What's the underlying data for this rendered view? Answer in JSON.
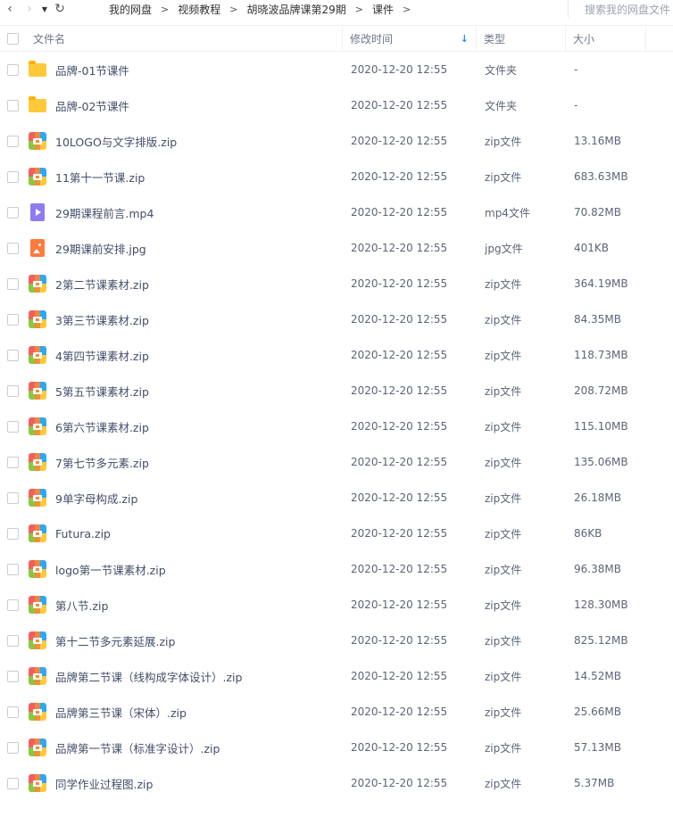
{
  "nav": {
    "breadcrumbs": [
      "我的网盘",
      "视频教程",
      "胡晓波品牌课第29期",
      "课件"
    ],
    "separator": ">",
    "search_placeholder": "搜索我的网盘文件"
  },
  "columns": {
    "name": "文件名",
    "mtime": "修改时间",
    "type": "类型",
    "size": "大小",
    "sort_indicator": "↓"
  },
  "files": [
    {
      "name": "品牌-01节课件",
      "mtime": "2020-12-20 12:55",
      "type": "文件夹",
      "size": "-",
      "icon": "folder"
    },
    {
      "name": "品牌-02节课件",
      "mtime": "2020-12-20 12:55",
      "type": "文件夹",
      "size": "-",
      "icon": "folder"
    },
    {
      "name": "10LOGO与文字排版.zip",
      "mtime": "2020-12-20 12:55",
      "type": "zip文件",
      "size": "13.16MB",
      "icon": "zip"
    },
    {
      "name": "11第十一节课.zip",
      "mtime": "2020-12-20 12:55",
      "type": "zip文件",
      "size": "683.63MB",
      "icon": "zip"
    },
    {
      "name": "29期课程前言.mp4",
      "mtime": "2020-12-20 12:55",
      "type": "mp4文件",
      "size": "70.82MB",
      "icon": "video"
    },
    {
      "name": "29期课前安排.jpg",
      "mtime": "2020-12-20 12:55",
      "type": "jpg文件",
      "size": "401KB",
      "icon": "image"
    },
    {
      "name": "2第二节课素材.zip",
      "mtime": "2020-12-20 12:55",
      "type": "zip文件",
      "size": "364.19MB",
      "icon": "zip"
    },
    {
      "name": "3第三节课素材.zip",
      "mtime": "2020-12-20 12:55",
      "type": "zip文件",
      "size": "84.35MB",
      "icon": "zip"
    },
    {
      "name": "4第四节课素材.zip",
      "mtime": "2020-12-20 12:55",
      "type": "zip文件",
      "size": "118.73MB",
      "icon": "zip"
    },
    {
      "name": "5第五节课素材.zip",
      "mtime": "2020-12-20 12:55",
      "type": "zip文件",
      "size": "208.72MB",
      "icon": "zip"
    },
    {
      "name": "6第六节课素材.zip",
      "mtime": "2020-12-20 12:55",
      "type": "zip文件",
      "size": "115.10MB",
      "icon": "zip"
    },
    {
      "name": "7第七节多元素.zip",
      "mtime": "2020-12-20 12:55",
      "type": "zip文件",
      "size": "135.06MB",
      "icon": "zip"
    },
    {
      "name": "9单字母构成.zip",
      "mtime": "2020-12-20 12:55",
      "type": "zip文件",
      "size": "26.18MB",
      "icon": "zip"
    },
    {
      "name": "Futura.zip",
      "mtime": "2020-12-20 12:55",
      "type": "zip文件",
      "size": "86KB",
      "icon": "zip"
    },
    {
      "name": "logo第一节课素材.zip",
      "mtime": "2020-12-20 12:55",
      "type": "zip文件",
      "size": "96.38MB",
      "icon": "zip"
    },
    {
      "name": "第八节.zip",
      "mtime": "2020-12-20 12:55",
      "type": "zip文件",
      "size": "128.30MB",
      "icon": "zip"
    },
    {
      "name": "第十二节多元素延展.zip",
      "mtime": "2020-12-20 12:55",
      "type": "zip文件",
      "size": "825.12MB",
      "icon": "zip"
    },
    {
      "name": "品牌第二节课（线构成字体设计）.zip",
      "mtime": "2020-12-20 12:55",
      "type": "zip文件",
      "size": "14.52MB",
      "icon": "zip"
    },
    {
      "name": "品牌第三节课（宋体）.zip",
      "mtime": "2020-12-20 12:55",
      "type": "zip文件",
      "size": "25.66MB",
      "icon": "zip"
    },
    {
      "name": "品牌第一节课（标准字设计）.zip",
      "mtime": "2020-12-20 12:55",
      "type": "zip文件",
      "size": "57.13MB",
      "icon": "zip"
    },
    {
      "name": "同学作业过程图.zip",
      "mtime": "2020-12-20 12:55",
      "type": "zip文件",
      "size": "5.37MB",
      "icon": "zip"
    }
  ]
}
